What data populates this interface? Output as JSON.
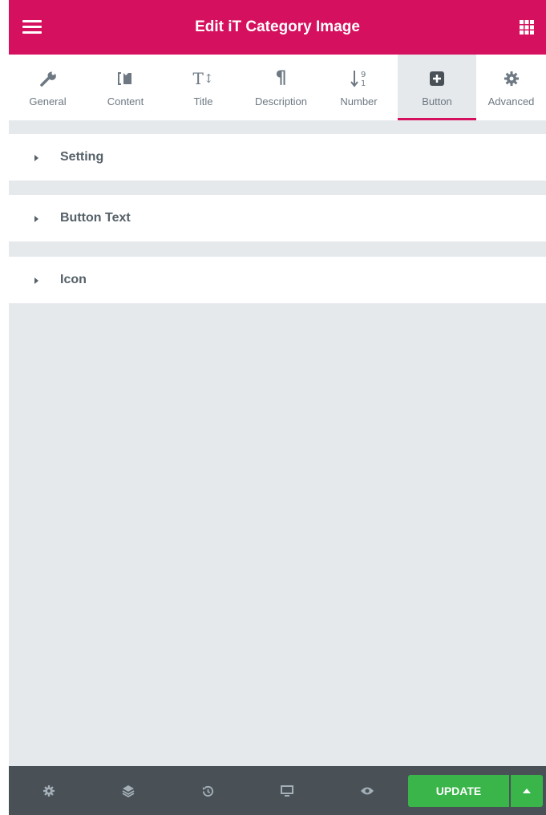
{
  "header": {
    "title": "Edit iT Category Image",
    "menu_icon": "hamburger-icon",
    "apps_icon": "grid-icon",
    "background_color": "#d5105e"
  },
  "tabs": [
    {
      "label": "General",
      "icon": "wrench-icon",
      "active": false
    },
    {
      "label": "Content",
      "icon": "content-icon",
      "active": false
    },
    {
      "label": "Title",
      "icon": "text-size-icon",
      "active": false
    },
    {
      "label": "Description",
      "icon": "paragraph-icon",
      "active": false
    },
    {
      "label": "Number",
      "icon": "sort-numeric-icon",
      "active": false
    },
    {
      "label": "Button",
      "icon": "plus-square-icon",
      "active": true
    },
    {
      "label": "Advanced",
      "icon": "gear-icon",
      "active": false
    }
  ],
  "sections": [
    {
      "title": "Setting"
    },
    {
      "title": "Button Text"
    },
    {
      "title": "Icon"
    }
  ],
  "footer": {
    "icons": [
      "settings-icon",
      "layers-icon",
      "history-icon",
      "responsive-icon",
      "preview-icon"
    ],
    "update_label": "UPDATE",
    "update_color": "#39b54a"
  }
}
